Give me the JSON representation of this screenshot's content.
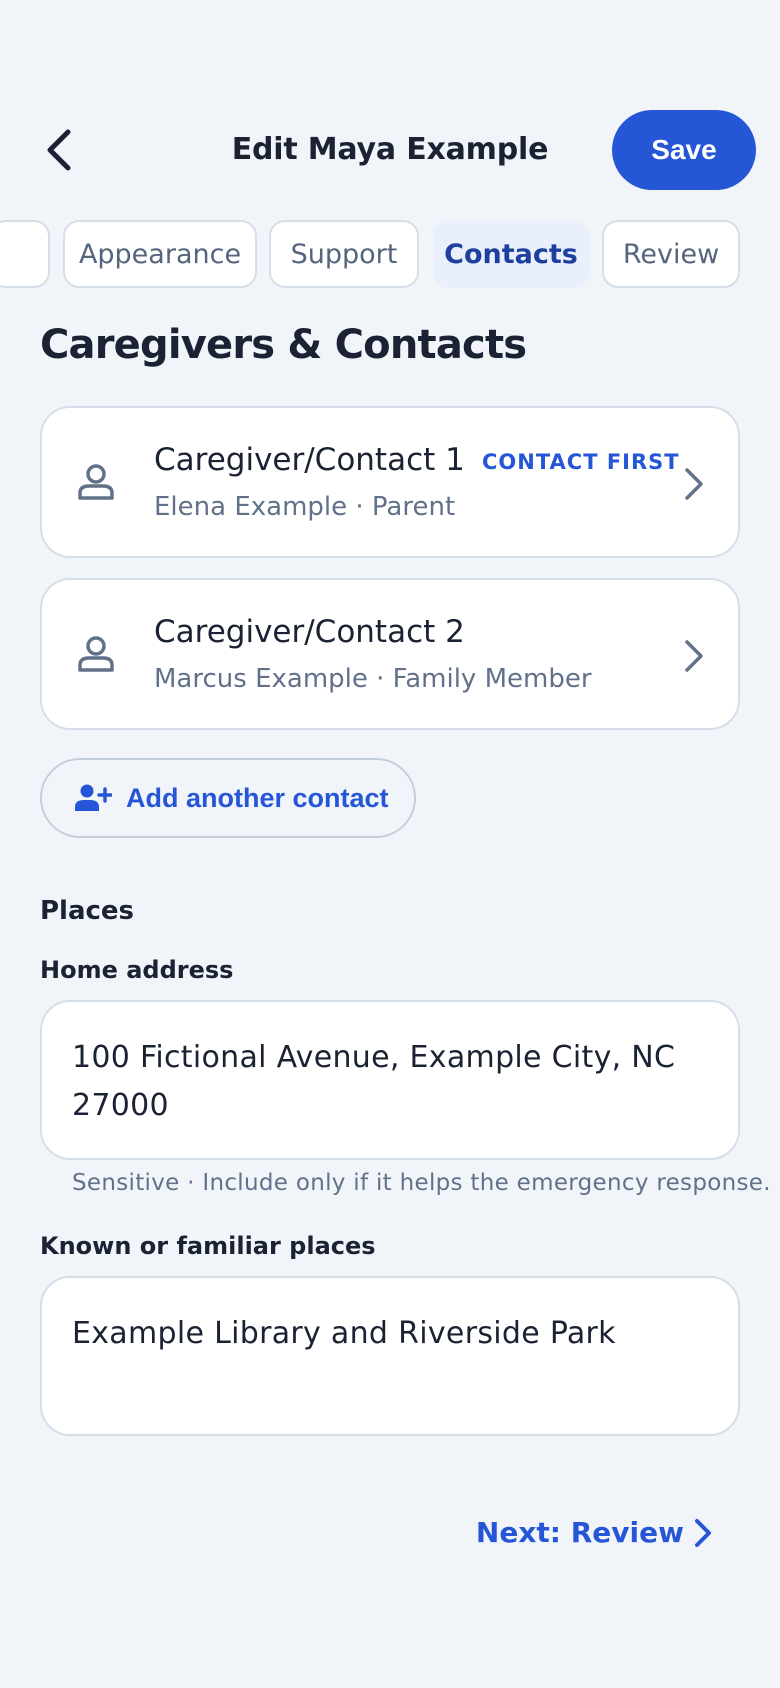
{
  "header": {
    "title": "Edit Maya Example",
    "save_label": "Save"
  },
  "tabs": [
    {
      "label": ""
    },
    {
      "label": "Appearance"
    },
    {
      "label": "Support"
    },
    {
      "label": "Contacts",
      "active": true
    },
    {
      "label": "Review"
    }
  ],
  "section": {
    "title": "Caregivers & Contacts"
  },
  "contacts": [
    {
      "title": "Caregiver/Contact 1",
      "subtitle": "Elena Example · Parent",
      "badge": "CONTACT FIRST"
    },
    {
      "title": "Caregiver/Contact 2",
      "subtitle": "Marcus Example · Family Member"
    }
  ],
  "add_contact": {
    "label": "Add another contact"
  },
  "places": {
    "heading": "Places",
    "home_label": "Home address",
    "home_value": "100 Fictional Avenue, Example City, NC 27000",
    "home_hint": "Sensitive · Include only if it helps the emergency response.",
    "familiar_label": "Known or familiar places",
    "familiar_value": "Example Library and Riverside Park"
  },
  "footer": {
    "next_label": "Next: Review"
  },
  "colors": {
    "accent": "#2556d6",
    "background": "#f1f5fa",
    "active_tab_bg": "#e9f0fb"
  },
  "icons": {
    "back": "chevron-left-icon",
    "person": "person-icon",
    "chevron": "chevron-right-icon",
    "add_contact": "person-add-icon"
  }
}
